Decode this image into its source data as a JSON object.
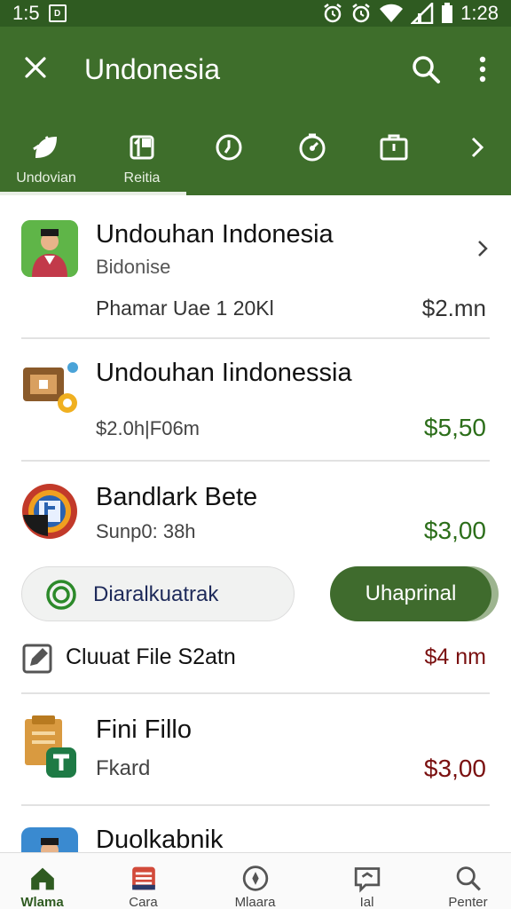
{
  "statusbar": {
    "left_time": "1:5",
    "left_badge": "D",
    "right_time": "1:28"
  },
  "appbar": {
    "title": "Undonesia",
    "tabs": [
      {
        "label": "Undovian",
        "icon": "leaf-icon"
      },
      {
        "label": "Reitia",
        "icon": "tag-icon"
      },
      {
        "label": "",
        "icon": "clock-icon"
      },
      {
        "label": "",
        "icon": "timer-icon"
      },
      {
        "label": "",
        "icon": "briefcase-icon"
      },
      {
        "label": "",
        "icon": "chevron-right-icon"
      }
    ]
  },
  "items": [
    {
      "name": "Undouhan Indonesia",
      "subtitle": "Bidonise",
      "detail": "Phamar Uae 1 20Kl",
      "price": "$2.mn",
      "price_color": "#333333"
    },
    {
      "name": "Undouhan Iindonessia",
      "subtitle": "$2.0h|F06m",
      "price": "$5,50",
      "price_color": "#2c6e1a"
    },
    {
      "name": "Bandlark Bete",
      "subtitle": "Sunp0: 38h",
      "price": "$3,00",
      "price_color": "#2c6e1a"
    },
    {
      "name": "Cluuat File S2atn",
      "price": "$4 nm",
      "price_color": "#7a1010"
    },
    {
      "name": "Fini Fillo",
      "subtitle": "Fkard",
      "price": "$3,00",
      "price_color": "#7a1010"
    },
    {
      "name": "Duolkabnik"
    }
  ],
  "actions": {
    "secondary_label": "Diaralkuatrak",
    "primary_label": "Uhaprinal"
  },
  "bottomnav": [
    {
      "label": "Wlama",
      "icon": "home-icon"
    },
    {
      "label": "Cara",
      "icon": "inbox-icon"
    },
    {
      "label": "Mlaara",
      "icon": "compass-icon"
    },
    {
      "label": "Ial",
      "icon": "chat-icon"
    },
    {
      "label": "Penter",
      "icon": "search-icon"
    }
  ],
  "colors": {
    "appbar": "#3e6e2b",
    "statusbar": "#2f5b21",
    "accent": "#2c6e1a"
  }
}
